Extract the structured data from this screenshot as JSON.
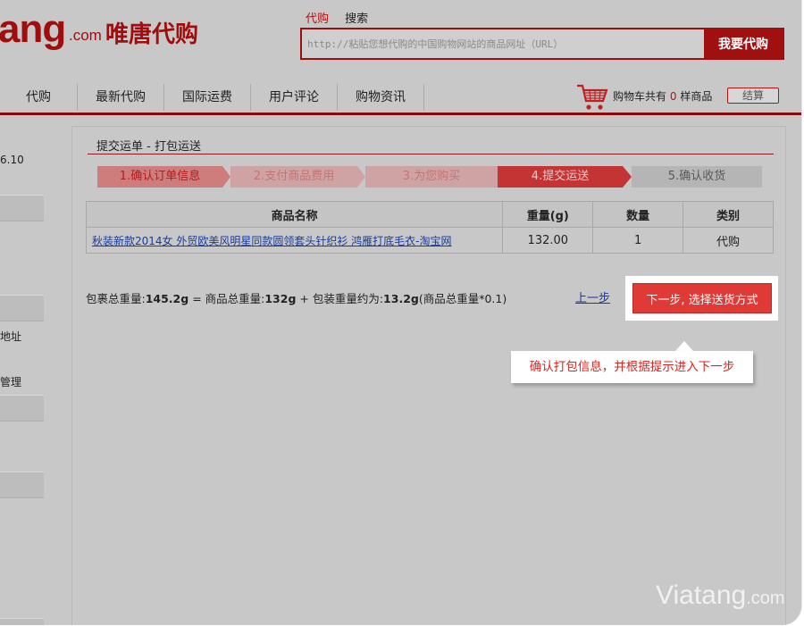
{
  "logo": {
    "brand": "ang",
    "com": ".com",
    "cn": "唯唐代购"
  },
  "top_tabs": {
    "active": "代购",
    "inactive": "搜索"
  },
  "search": {
    "placeholder": "http://粘贴您想代购的中国购物网站的商品网址（URL）",
    "button": "我要代购"
  },
  "nav": {
    "items": [
      "代购",
      "最新代购",
      "国际运费",
      "用户评论",
      "购物资讯"
    ]
  },
  "cart": {
    "prefix": "购物车共有",
    "count": "0",
    "suffix": "样商品",
    "checkout": "结算"
  },
  "sidebar": {
    "texts": [
      "6.10",
      "地址",
      "管理"
    ]
  },
  "panel": {
    "title": "提交运单 - 打包运送",
    "steps": [
      "1.确认订单信息",
      "2.支付商品费用",
      "3.为您购买",
      "4.提交运送",
      "5.确认收货"
    ],
    "table": {
      "headers": [
        "商品名称",
        "重量(g)",
        "数量",
        "类别"
      ],
      "rows": [
        {
          "name": "秋装新款2014女 外贸欧美风明星同款圆领套头针织衫 鸿雁打底毛衣-淘宝网",
          "weight": "132.00",
          "qty": "1",
          "type": "代购"
        }
      ]
    },
    "weight": {
      "p1": "包裹总重量:",
      "v1": "145.2g",
      "p2": " = 商品总重量:",
      "v2": "132g",
      "p3": "  + 包装重量约为:",
      "v3": "13.2g",
      "p4": "(商品总重量*0.1)"
    },
    "prev": "上一步",
    "next": "下一步, 选择送货方式"
  },
  "tip": "确认打包信息，并根据提示进入下一步",
  "watermark": {
    "main": "Viatang",
    "suffix": ".com"
  }
}
